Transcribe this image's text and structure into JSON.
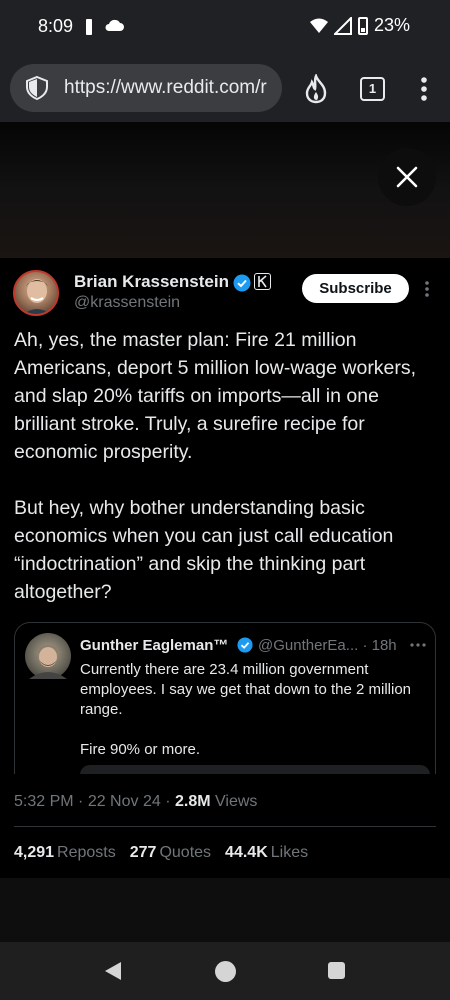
{
  "status_bar": {
    "time": "8:09",
    "battery": "23%"
  },
  "browser": {
    "url": "https://www.reddit.com/r",
    "tab_count": "1"
  },
  "tweet": {
    "author": {
      "name": "Brian Krassenstein",
      "handle": "@krassenstein",
      "verified": true,
      "affiliate_badge": "K"
    },
    "subscribe_label": "Subscribe",
    "paragraphs": [
      "Ah, yes, the master plan: Fire 21 million Americans, deport 5 million low-wage workers, and slap 20% tariffs on imports—all in one brilliant stroke. Truly, a surefire recipe for economic prosperity.",
      "But hey, why bother understanding basic economics when you can just call education “indoctrination” and skip the thinking part altogether?"
    ],
    "quote": {
      "name": "Gunther Eagleman™",
      "handle": "@GuntherEa...",
      "age": "18h",
      "paragraphs": [
        "Currently there are 23.4 million government employees.  I say we get that down to the 2 million range.",
        "Fire 90% or more."
      ]
    },
    "meta": {
      "time": "5:32 PM",
      "date": "22 Nov 24",
      "views_count": "2.8M",
      "views_label": "Views"
    },
    "stats": {
      "reposts_count": "4,291",
      "reposts_label": "Reposts",
      "quotes_count": "277",
      "quotes_label": "Quotes",
      "likes_count": "44.4K",
      "likes_label": "Likes"
    }
  },
  "colors": {
    "background": "#000000",
    "verified_blue": "#1d9bf0",
    "secondary_text": "#71767b",
    "browser_chrome": "#202124"
  }
}
